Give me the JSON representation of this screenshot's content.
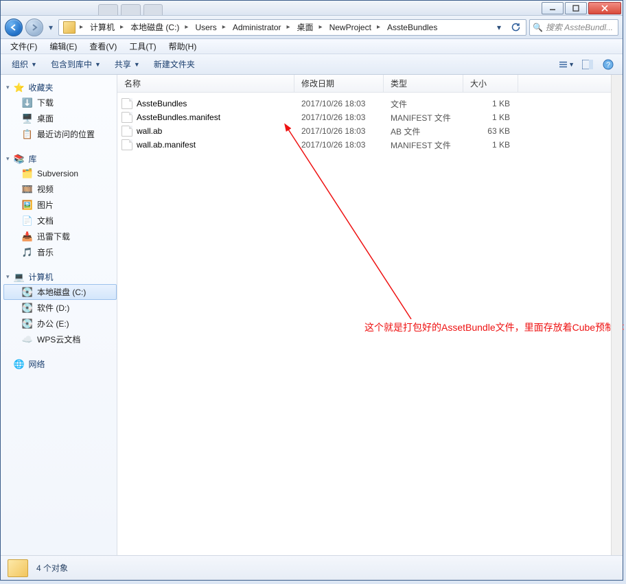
{
  "window": {
    "controls": {
      "minimize": "–",
      "maximize": "□",
      "close": "X"
    }
  },
  "nav": {
    "breadcrumbs": [
      "计算机",
      "本地磁盘 (C:)",
      "Users",
      "Administrator",
      "桌面",
      "NewProject",
      "AssteBundles"
    ],
    "search_placeholder": "搜索 AssteBundl..."
  },
  "menu": {
    "file": "文件(F)",
    "edit": "编辑(E)",
    "view": "查看(V)",
    "tools": "工具(T)",
    "help": "帮助(H)"
  },
  "toolbar": {
    "organize": "组织",
    "include_in_library": "包含到库中",
    "share": "共享",
    "new_folder": "新建文件夹"
  },
  "sidebar": {
    "favorites": {
      "label": "收藏夹",
      "items": [
        {
          "label": "下载"
        },
        {
          "label": "桌面"
        },
        {
          "label": "最近访问的位置"
        }
      ]
    },
    "libraries": {
      "label": "库",
      "items": [
        {
          "label": "Subversion"
        },
        {
          "label": "视频"
        },
        {
          "label": "图片"
        },
        {
          "label": "文档"
        },
        {
          "label": "迅雷下载"
        },
        {
          "label": "音乐"
        }
      ]
    },
    "computer": {
      "label": "计算机",
      "items": [
        {
          "label": "本地磁盘 (C:)",
          "selected": true
        },
        {
          "label": "软件 (D:)"
        },
        {
          "label": "办公 (E:)"
        },
        {
          "label": "WPS云文档"
        }
      ]
    },
    "network": {
      "label": "网络"
    }
  },
  "columns": {
    "name": "名称",
    "date": "修改日期",
    "type": "类型",
    "size": "大小"
  },
  "files": [
    {
      "name": "AssteBundles",
      "date": "2017/10/26 18:03",
      "type": "文件",
      "size": "1 KB"
    },
    {
      "name": "AssteBundles.manifest",
      "date": "2017/10/26 18:03",
      "type": "MANIFEST 文件",
      "size": "1 KB"
    },
    {
      "name": "wall.ab",
      "date": "2017/10/26 18:03",
      "type": "AB 文件",
      "size": "63 KB"
    },
    {
      "name": "wall.ab.manifest",
      "date": "2017/10/26 18:03",
      "type": "MANIFEST 文件",
      "size": "1 KB"
    }
  ],
  "annotation": "这个就是打包好的AssetBundle文件，里面存放着Cube预制体",
  "status": {
    "count_label": "4 个对象"
  }
}
